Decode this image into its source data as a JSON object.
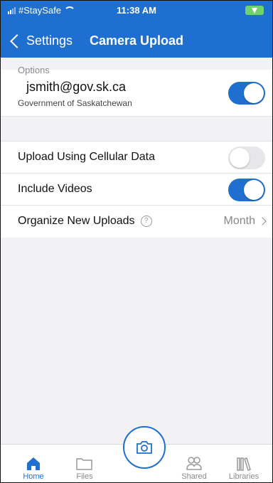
{
  "status_bar": {
    "carrier": "#StaySafe",
    "time": "11:38 AM"
  },
  "nav": {
    "back_label": "Settings",
    "title": "Camera Upload"
  },
  "account": {
    "email": "jsmith@gov.sk.ca",
    "organization": "Government of Saskatchewan",
    "enabled": true
  },
  "options": {
    "header": "Options",
    "items": [
      {
        "label": "Upload Using Cellular Data",
        "type": "toggle",
        "on": false
      },
      {
        "label": "Include Videos",
        "type": "toggle",
        "on": true
      },
      {
        "label": "Organize New Uploads",
        "type": "value",
        "value": "Month",
        "help": "?"
      }
    ]
  },
  "tabbar": {
    "items": [
      {
        "label": "Home",
        "icon": "home-icon",
        "active": true
      },
      {
        "label": "Files",
        "icon": "folder-icon",
        "active": false
      },
      {
        "label": "",
        "icon": "camera-icon",
        "active": false
      },
      {
        "label": "Shared",
        "icon": "people-icon",
        "active": false
      },
      {
        "label": "Libraries",
        "icon": "library-icon",
        "active": false
      }
    ]
  },
  "colors": {
    "accent": "#1f6fd1",
    "background": "#f2f2f5",
    "toggle_off": "#e7e7ea",
    "battery": "#6ed36e"
  }
}
